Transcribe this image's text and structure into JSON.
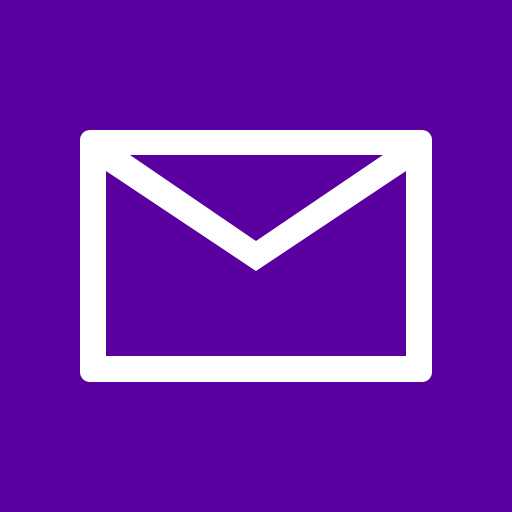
{
  "app_tile": {
    "icon": "mail-envelope-icon",
    "background_color": "#5b00a0",
    "icon_color": "#ffffff"
  }
}
